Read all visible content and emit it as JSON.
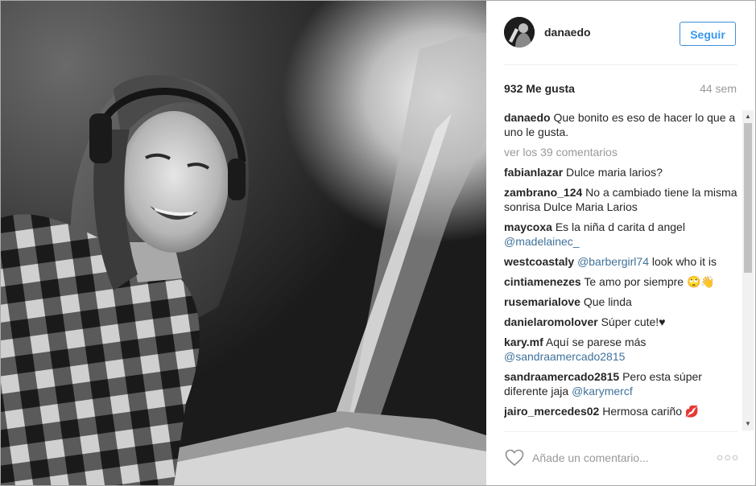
{
  "post": {
    "username": "danaedo",
    "follow_label": "Seguir",
    "likes": "932 Me gusta",
    "time_ago": "44 sem",
    "caption_author": "danaedo",
    "caption_text": "Que bonito es eso de hacer lo que a uno le gusta.",
    "view_all_label": "ver los 39 comentarios",
    "add_comment_placeholder": "Añade un comentario...",
    "more_options": "○○○"
  },
  "comments": [
    {
      "author": "fabianlazar",
      "text": "Dulce maria larios?",
      "mention": ""
    },
    {
      "author": "zambrano_124",
      "text": "No a cambiado tiene la misma sonrisa Dulce Maria Larios",
      "mention": ""
    },
    {
      "author": "maycoxa",
      "text": "Es la niña d carita d angel",
      "mention": "@madelainec_"
    },
    {
      "author": "westcoastaly",
      "text": "",
      "mention": "@barbergirl74",
      "text_after": "look who it is"
    },
    {
      "author": "cintiamenezes",
      "text": "Te amo por siempre 🙄👋",
      "mention": ""
    },
    {
      "author": "rusemarialove",
      "text": "Que linda",
      "mention": ""
    },
    {
      "author": "danielaromolover",
      "text": "Súper cute!♥",
      "mention": ""
    },
    {
      "author": "kary.mf",
      "text": "Aquí se parese más",
      "mention": "@sandraamercado2815"
    },
    {
      "author": "sandraamercado2815",
      "text": "Pero esta súper diferente jaja",
      "mention": "@karymercf"
    },
    {
      "author": "jairo_mercedes02",
      "text": "Hermosa cariño 💋",
      "mention": ""
    }
  ],
  "icons": {
    "heart": "heart-outline-icon",
    "scroll_up": "scroll-up-arrow",
    "scroll_down": "scroll-down-arrow"
  },
  "colors": {
    "link_blue": "#3897f0",
    "mention_blue": "#3f729b",
    "muted_gray": "#999999"
  }
}
